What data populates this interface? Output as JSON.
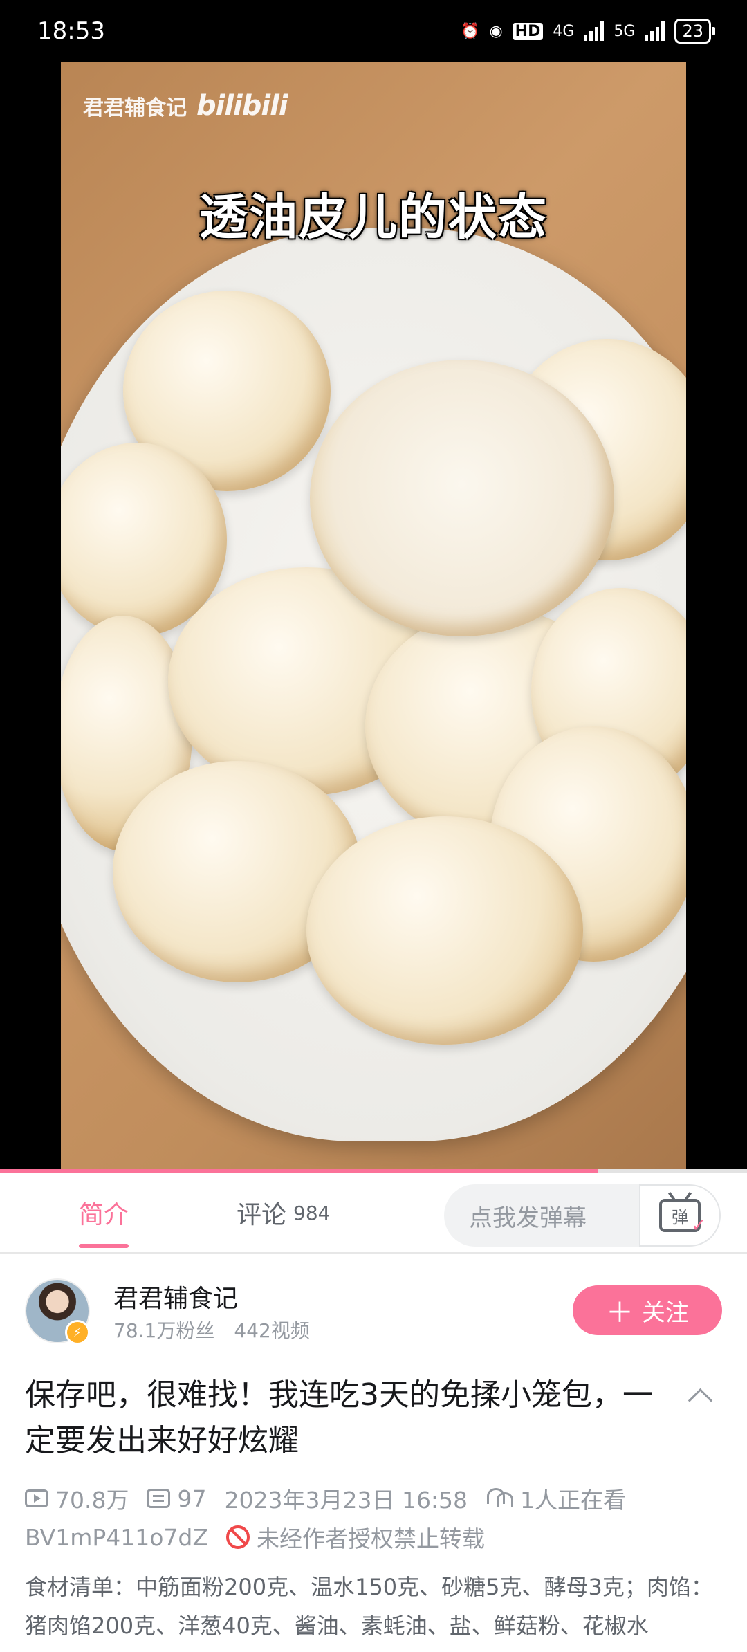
{
  "status_bar": {
    "time": "18:53",
    "network_labels": [
      "HD",
      "4G",
      "5G"
    ],
    "battery": "23"
  },
  "video": {
    "watermark_channel": "君君辅食记",
    "watermark_logo": "bilibili",
    "caption": "透油皮儿的状态",
    "progress_fraction": 0.8
  },
  "tabs": {
    "intro": "简介",
    "comments": "评论",
    "comments_count": "984",
    "danmaku_placeholder": "点我发弹幕",
    "danmaku_icon_text": "弹"
  },
  "uploader": {
    "name": "君君辅食记",
    "followers": "78.1万粉丝",
    "videos": "442视频",
    "follow_label": "关注"
  },
  "video_info": {
    "title": "保存吧，很难找！我连吃3天的免揉小笼包，一定要发出来好好炫耀",
    "plays": "70.8万",
    "danmaku_count": "97",
    "publish_time": "2023年3月23日 16:58",
    "watching": "1人正在看",
    "bvid": "BV1mP411o7dZ",
    "copyright_notice": "未经作者授权禁止转载",
    "description": "食材清单：中筋面粉200克、温水150克、砂糖5克、酵母3克；肉馅：猪肉馅200克、洋葱40克、酱油、素蚝油、盐、鲜菇粉、花椒水"
  },
  "colors": {
    "accent": "#fb7299",
    "secondary_text": "#9499a0",
    "warning": "#f0494a"
  }
}
